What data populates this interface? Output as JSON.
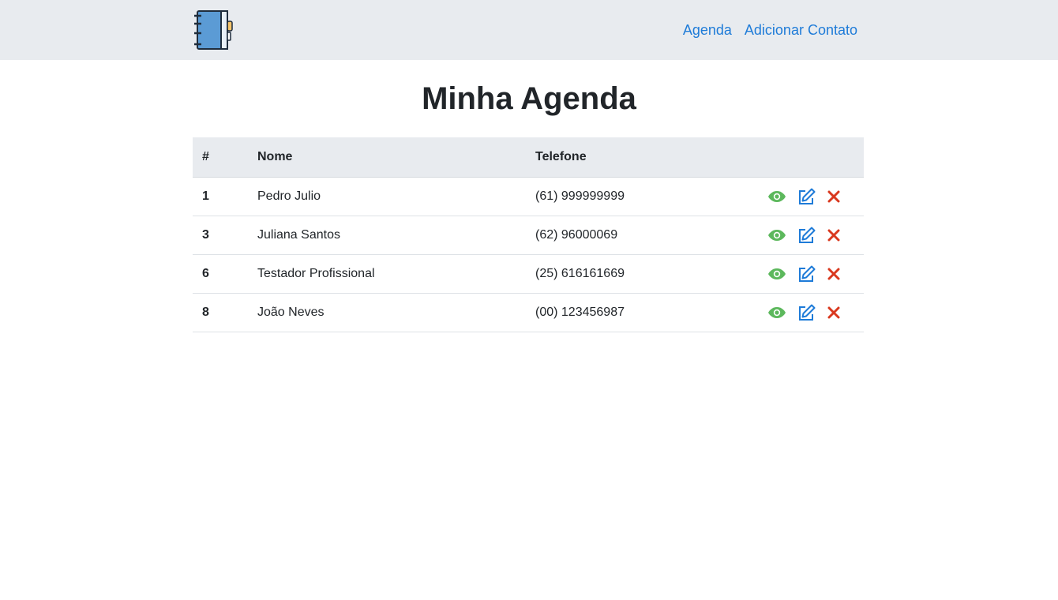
{
  "navbar": {
    "logo_icon": "address-book-icon",
    "links": [
      {
        "label": "Agenda"
      },
      {
        "label": "Adicionar Contato"
      }
    ],
    "link_color": "#1e7bd8"
  },
  "page": {
    "title": "Minha Agenda"
  },
  "table": {
    "headers": {
      "id": "#",
      "name": "Nome",
      "phone": "Telefone"
    },
    "rows": [
      {
        "id": "1",
        "name": "Pedro Julio",
        "phone": "(61) 999999999"
      },
      {
        "id": "3",
        "name": "Juliana Santos",
        "phone": "(62) 96000069"
      },
      {
        "id": "6",
        "name": "Testador Profissional",
        "phone": "(25) 616161669"
      },
      {
        "id": "8",
        "name": "João Neves",
        "phone": "(00) 123456987"
      }
    ],
    "row_actions": [
      {
        "icon": "eye-icon",
        "color": "#5cb85c"
      },
      {
        "icon": "edit-icon",
        "color": "#1e7bd8"
      },
      {
        "icon": "close-icon",
        "color": "#d9381e"
      }
    ]
  }
}
